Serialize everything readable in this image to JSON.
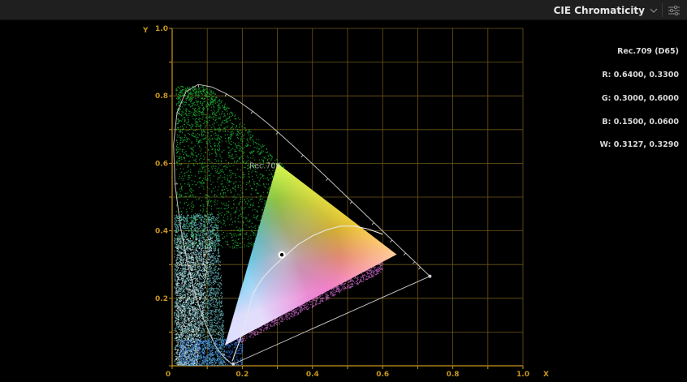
{
  "toolbar": {
    "scope_name": "CIE Chromaticity",
    "dropdown_icon": "chevron-down-icon",
    "settings_icon": "sliders-icon"
  },
  "chart": {
    "x_axis_letter": "X",
    "y_axis_letter": "Y",
    "x_ticks": [
      "0",
      "0.2",
      "0.4",
      "0.6",
      "0.8",
      "1.0"
    ],
    "y_ticks": [
      "0.2",
      "0.4",
      "0.6",
      "0.8",
      "1.0"
    ],
    "gamut_label": "Rec.709",
    "colors": {
      "axis": "#c8961e",
      "grid": "#6d5616",
      "locus": "#e0e0e0"
    }
  },
  "readout": {
    "title": "Rec.709 (D65)",
    "r": "R: 0.6400, 0.3300",
    "g": "G: 0.3000, 0.6000",
    "b": "B: 0.1500, 0.0600",
    "w": "W: 0.3127, 0.3290"
  }
}
